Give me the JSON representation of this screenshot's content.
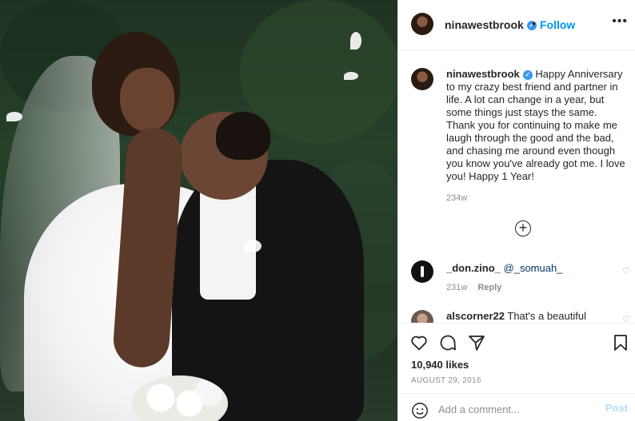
{
  "post": {
    "image_alt": "",
    "header": {
      "username": "ninawestbrook",
      "separator": "•",
      "follow_label": "Follow",
      "more_label": "•••"
    },
    "caption": {
      "username": "ninawestbrook",
      "text": "Happy Anniversary to my crazy best friend and partner in life. A lot can change in a year, but some things just stays the same. Thank you for continuing to make me laugh through the good and the bad, and chasing me around even though you know you've already got me. I love you! Happy 1 Year!",
      "time": "234w"
    },
    "comments": [
      {
        "username": "_don.zino_",
        "mention": "@_somuah_",
        "time": "231w",
        "reply_label": "Reply"
      },
      {
        "username": "alscorner22",
        "text": "That's a beautiful"
      }
    ],
    "likes": "10,940 likes",
    "date": "AUGUST 29, 2016",
    "comment_box": {
      "placeholder": "Add a comment...",
      "post_label": "Post"
    },
    "icons": [
      "verified-badge-icon",
      "more-icon",
      "load-more-comments-icon",
      "heart-icon",
      "comment-icon",
      "share-icon",
      "bookmark-icon",
      "emoji-icon"
    ],
    "colors": {
      "follow": "#0095f6",
      "verified": "#3897f0",
      "post_disabled": "#b2dffc",
      "muted": "#8e8e8e"
    }
  }
}
